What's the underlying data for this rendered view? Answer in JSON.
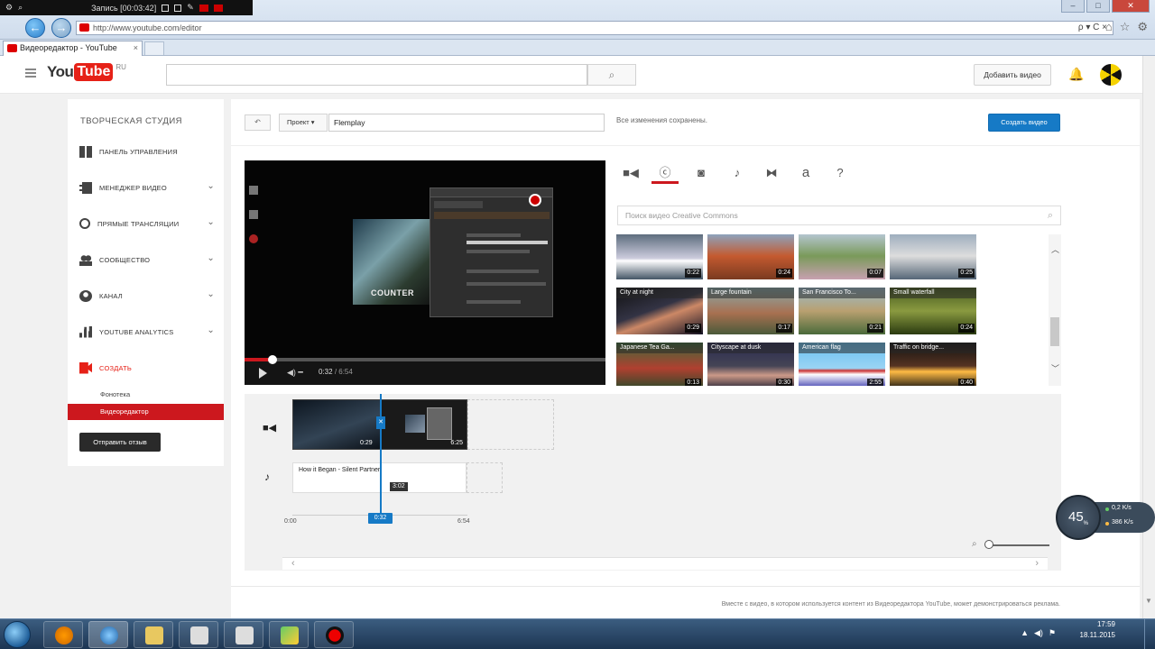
{
  "recorder": {
    "label": "Запись [00:03:42]"
  },
  "browser": {
    "url": "http://www.youtube.com/editor",
    "tab_title": "Видеоредактор - YouTube",
    "tools": "ρ ▾ C ×"
  },
  "header": {
    "logo_you": "You",
    "logo_tube": "Tube",
    "logo_region": "RU",
    "search_placeholder": "",
    "upload_label": "Добавить видео"
  },
  "sidebar": {
    "title": "ТВОРЧЕСКАЯ СТУДИЯ",
    "items": [
      {
        "label": "ПАНЕЛЬ УПРАВЛЕНИЯ",
        "icon": "dashboard-icon"
      },
      {
        "label": "МЕНЕДЖЕР ВИДЕО",
        "icon": "film-icon"
      },
      {
        "label": "ПРЯМЫЕ ТРАНСЛЯЦИИ",
        "icon": "broadcast-icon"
      },
      {
        "label": "СООБЩЕСТВО",
        "icon": "community-icon"
      },
      {
        "label": "КАНАЛ",
        "icon": "channel-icon"
      },
      {
        "label": "YOUTUBE ANALYTICS",
        "icon": "analytics-icon"
      },
      {
        "label": "СОЗДАТЬ",
        "icon": "create-icon"
      }
    ],
    "sub_items": [
      "Фонотека",
      "Видеоредактор"
    ],
    "feedback_label": "Отправить отзыв",
    "accent_color": "#cc181e"
  },
  "editor": {
    "undo_label": "↶",
    "project_label": "Проект ▾",
    "project_name": "Flemplay",
    "saved_status": "Все изменения сохранены.",
    "create_video_label": "Создать видео",
    "player": {
      "current_time": "0:32",
      "duration": "/ 6:54",
      "game_title": "COUNTER",
      "progress": 0.077
    },
    "tools": [
      "video-tab-icon",
      "creative-commons-tab-icon",
      "photo-tab-icon",
      "audio-tab-icon",
      "transitions-tab-icon",
      "text-tab-icon",
      "help-tab-icon"
    ],
    "cc_search_placeholder": "Поиск видео Creative Commons",
    "thumbnails": [
      {
        "title": "",
        "duration": "0:22",
        "bg": "linear-gradient(180deg,#556677,#ccd 55%,#fff 60%,#456)"
      },
      {
        "title": "",
        "duration": "0:24",
        "bg": "linear-gradient(180deg,#89a9c8,#c45a30 50%,#7a3a20)"
      },
      {
        "title": "",
        "duration": "0:07",
        "bg": "linear-gradient(180deg,#b9c9d9,#7a9a5a 50%,#c8a0b0)"
      },
      {
        "title": "",
        "duration": "0:25",
        "bg": "linear-gradient(180deg,#9ab,#ddd 50%,#567)"
      },
      {
        "title": "City at night",
        "duration": "0:29",
        "bg": "linear-gradient(160deg,#111,#334 45%,#c86 60%,#112)"
      },
      {
        "title": "Large fountain",
        "duration": "0:17",
        "bg": "linear-gradient(180deg,#8aa,#a87050 55%,#4a5a3a)"
      },
      {
        "title": "San Francisco To...",
        "duration": "0:21",
        "bg": "linear-gradient(180deg,#9bc,#b9a070 50%,#4a6a3a)"
      },
      {
        "title": "Small waterfall",
        "duration": "0:24",
        "bg": "linear-gradient(180deg,#465a20,#8a9a40 50%,#2a3a10)"
      },
      {
        "title": "Japanese Tea Ga...",
        "duration": "0:13",
        "bg": "linear-gradient(180deg,#3a6a3a,#b04030 55%,#2a4a2a)"
      },
      {
        "title": "Cityscape at dusk",
        "duration": "0:30",
        "bg": "linear-gradient(180deg,#2a2a50,#445 50%,#c98 70%,#223)"
      },
      {
        "title": "American flag",
        "duration": "2:55",
        "bg": "linear-gradient(180deg,#6ac0f0,#9ad4f5 55%,#c33 60%,#fff 68%,#33a)"
      },
      {
        "title": "Traffic on bridge...",
        "duration": "0:40",
        "bg": "linear-gradient(180deg,#111,#532 50%,#fb4 62%,#111)"
      }
    ]
  },
  "timeline": {
    "clip1_duration": "0:29",
    "clip2_duration": "6:25",
    "audio_title": "How it Began - Silent Partner",
    "audio_duration": "3:02",
    "start_time": "0:00",
    "end_time": "6:54",
    "playhead_time": "0:32",
    "playhead_color": "#167ac6"
  },
  "footer": {
    "note": "Вместе с видео, в котором используется контент из Видеоредактора YouTube, может демонстрироваться реклама."
  },
  "speed_widget": {
    "percent": "45",
    "unit": "%",
    "upload": "0,2",
    "upload_unit": "K/s",
    "download": "386",
    "download_unit": "K/s"
  },
  "taskbar": {
    "time": "17:59",
    "date": "18.11.2015"
  }
}
